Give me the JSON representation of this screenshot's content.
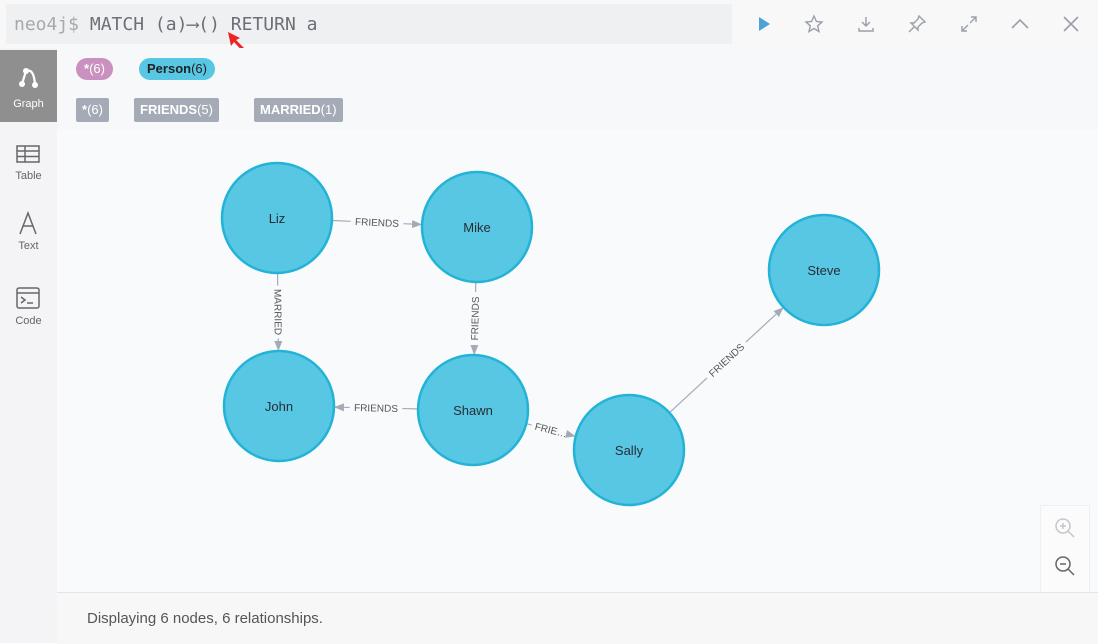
{
  "command": {
    "prompt": "neo4j$",
    "query": "MATCH (a)⟶() RETURN a"
  },
  "toolbar": {
    "run": "play-icon",
    "favorite": "star-icon",
    "download": "download-icon",
    "pin": "pin-icon",
    "fullscreen": "expand-icon",
    "collapse": "chevron-up-icon",
    "close": "close-icon"
  },
  "sidebar": {
    "items": [
      {
        "label": "Graph",
        "icon": "graph-icon",
        "active": true
      },
      {
        "label": "Table",
        "icon": "table-icon",
        "active": false
      },
      {
        "label": "Text",
        "icon": "text-icon",
        "active": false
      },
      {
        "label": "Code",
        "icon": "code-icon",
        "active": false
      }
    ]
  },
  "node_labels": [
    {
      "name": "*",
      "count": "(6)",
      "color": "#c990c0"
    },
    {
      "name": "Person",
      "count": "(6)",
      "color": "#57c7e3"
    }
  ],
  "relationship_types": [
    {
      "name": "*",
      "count": "(6)"
    },
    {
      "name": "FRIENDS",
      "count": "(5)"
    },
    {
      "name": "MARRIED",
      "count": "(1)"
    }
  ],
  "graph": {
    "node_color": "#57c7e3",
    "node_border": "#23b3d7",
    "nodes": [
      {
        "id": "liz",
        "label": "Liz"
      },
      {
        "id": "mike",
        "label": "Mike"
      },
      {
        "id": "john",
        "label": "John"
      },
      {
        "id": "shawn",
        "label": "Shawn"
      },
      {
        "id": "sally",
        "label": "Sally"
      },
      {
        "id": "steve",
        "label": "Steve"
      }
    ],
    "relationships": [
      {
        "from": "liz",
        "to": "mike",
        "type": "FRIENDS"
      },
      {
        "from": "liz",
        "to": "john",
        "type": "MARRIED"
      },
      {
        "from": "mike",
        "to": "shawn",
        "type": "FRIENDS"
      },
      {
        "from": "shawn",
        "to": "john",
        "type": "FRIENDS"
      },
      {
        "from": "shawn",
        "to": "sally",
        "type": "FRIE…"
      },
      {
        "from": "sally",
        "to": "steve",
        "type": "FRIENDS"
      }
    ]
  },
  "zoom": {
    "in": "zoom-in-icon",
    "out": "zoom-out-icon"
  },
  "status": "Displaying 6 nodes, 6 relationships."
}
